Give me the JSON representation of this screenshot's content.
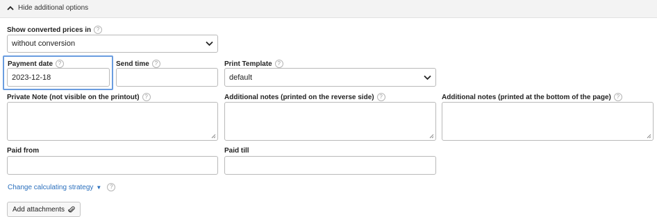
{
  "toggle": {
    "label": "Hide additional options",
    "icon": "chevron-up-icon"
  },
  "currency": {
    "label": "Show converted prices in",
    "help": "?",
    "selected": "without conversion"
  },
  "payment_date": {
    "label": "Payment date",
    "help": "?",
    "value": "2023-12-18"
  },
  "send_time": {
    "label": "Send time",
    "help": "?",
    "value": ""
  },
  "print_template": {
    "label": "Print Template",
    "help": "?",
    "selected": "default"
  },
  "private_note": {
    "label": "Private Note (not visible on the printout)",
    "help": "?",
    "value": ""
  },
  "notes_reverse": {
    "label": "Additional notes (printed on the reverse side)",
    "help": "?",
    "value": ""
  },
  "notes_bottom": {
    "label": "Additional notes (printed at the bottom of the page)",
    "help": "?",
    "value": ""
  },
  "paid_from": {
    "label": "Paid from",
    "value": ""
  },
  "paid_till": {
    "label": "Paid till",
    "value": ""
  },
  "strategy": {
    "label": "Change calculating strategy",
    "help": "?"
  },
  "attachments": {
    "label": "Add attachments",
    "icon": "paperclip-icon"
  },
  "colors": {
    "link": "#2a6fbd",
    "focus": "#6a9de0"
  }
}
